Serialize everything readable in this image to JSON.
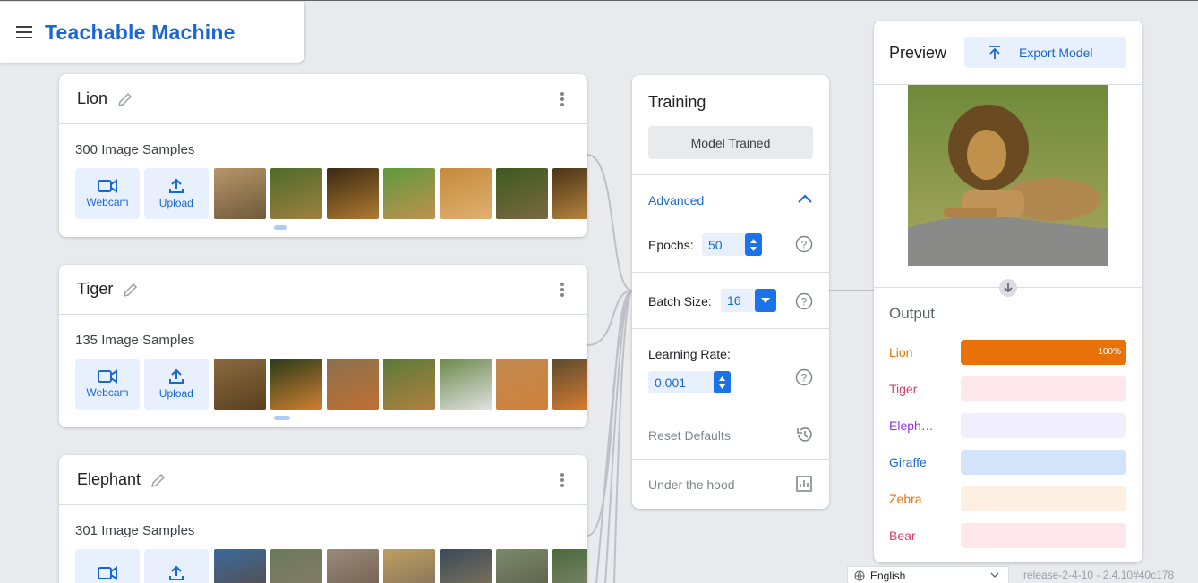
{
  "app": {
    "title": "Teachable Machine"
  },
  "classes": [
    {
      "name": "Lion",
      "samples": "300 Image Samples",
      "webcam": "Webcam",
      "upload": "Upload",
      "thumb_colors": [
        [
          "#b8956a",
          "#6e5a3a"
        ],
        [
          "#4d6b2a",
          "#a08040"
        ],
        [
          "#3a2a14",
          "#b07a30"
        ],
        [
          "#5e9a3c",
          "#c09050"
        ],
        [
          "#c48a3c",
          "#e0b070"
        ],
        [
          "#3d5a20",
          "#7a6840"
        ],
        [
          "#4a3418",
          "#c08a40"
        ]
      ]
    },
    {
      "name": "Tiger",
      "samples": "135 Image Samples",
      "webcam": "Webcam",
      "upload": "Upload",
      "thumb_colors": [
        [
          "#8a6a40",
          "#5a4020"
        ],
        [
          "#2a3a1a",
          "#d08030"
        ],
        [
          "#8a7050",
          "#c07030"
        ],
        [
          "#5a7a3a",
          "#b08040"
        ],
        [
          "#6a8a4a",
          "#e0e0e0"
        ],
        [
          "#c08a50",
          "#d0803a"
        ],
        [
          "#5a4a30",
          "#e08030"
        ]
      ]
    },
    {
      "name": "Elephant",
      "samples": "301 Image Samples",
      "webcam": "Webcam",
      "upload": "Upload",
      "thumb_colors": [
        [
          "#3a6aa0",
          "#5a4a3a"
        ],
        [
          "#6a7a5a",
          "#8a7a6a"
        ],
        [
          "#9a8a7a",
          "#6a5a4a"
        ],
        [
          "#c0a060",
          "#7a6a5a"
        ],
        [
          "#3a4a5a",
          "#8a7a5a"
        ],
        [
          "#7a8a6a",
          "#5a5a4a"
        ],
        [
          "#4a6a3a",
          "#8a8a7a"
        ]
      ]
    }
  ],
  "training": {
    "title": "Training",
    "status_button": "Model Trained",
    "advanced": "Advanced",
    "epochs_label": "Epochs:",
    "epochs_value": "50",
    "batch_label": "Batch Size:",
    "batch_value": "16",
    "lr_label": "Learning Rate:",
    "lr_value": "0.001",
    "reset": "Reset Defaults",
    "under_hood": "Under the hood"
  },
  "preview": {
    "title": "Preview",
    "export_button": "Export Model",
    "output_title": "Output",
    "outputs": [
      {
        "label": "Lion",
        "color": "#e8710a",
        "bg": "#e8710a",
        "value": 1.0,
        "pct_text": "100%"
      },
      {
        "label": "Tiger",
        "color": "#d93c66",
        "bg": "#fde7ea",
        "value": 0,
        "pct_text": ""
      },
      {
        "label": "Eleph…",
        "color": "#9334e6",
        "bg": "#f1effd",
        "value": 0,
        "pct_text": ""
      },
      {
        "label": "Giraffe",
        "color": "#1967d2",
        "bg": "#d2e3fc",
        "value": 0,
        "pct_text": ""
      },
      {
        "label": "Zebra",
        "color": "#e8710a",
        "bg": "#feefe3",
        "value": 0,
        "pct_text": ""
      },
      {
        "label": "Bear",
        "color": "#d93c66",
        "bg": "#fde7ea",
        "value": 0,
        "pct_text": ""
      }
    ]
  },
  "footer": {
    "language": "English",
    "version": "release-2-4-10 - 2.4.10#40c178"
  }
}
